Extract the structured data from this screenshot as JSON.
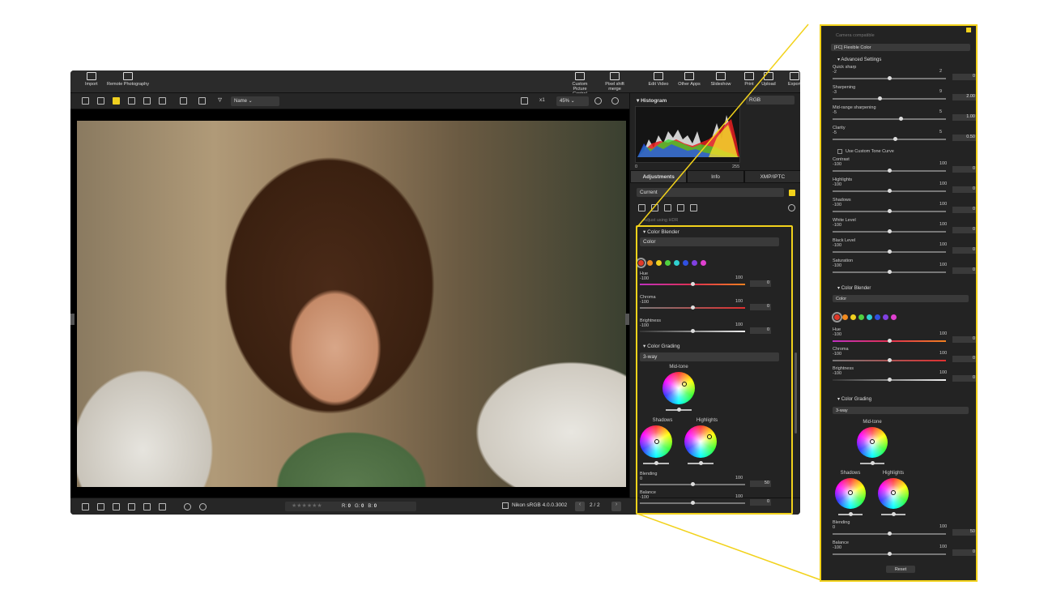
{
  "toolbar": {
    "left": [
      "Import",
      "Remote Photography"
    ],
    "right": [
      "Custom Picture Control",
      "Pixel shift merge",
      "Edit Video",
      "Other Apps",
      "Slideshow",
      "Print",
      "Upload",
      "Export"
    ]
  },
  "view": {
    "sort": "Name",
    "zoom_x": "x1",
    "zoom": "45%"
  },
  "bottombar": {
    "r_label": "R:",
    "r_value": "0",
    "g_label": "G:",
    "g_value": "0",
    "b_label": "B:",
    "b_value": "0",
    "profile": "Nikon sRGB 4.0.0.3002",
    "page": "2",
    "of": "2"
  },
  "histogram": {
    "title": "Histogram",
    "channel": "RGB",
    "min": "0",
    "max": "255"
  },
  "tabs": [
    "Adjustments",
    "Info",
    "XMP/IPTC"
  ],
  "panel": {
    "preset": "Current",
    "adjust_hdr": "Adjust using HDR",
    "color_blender": {
      "title": "Color Blender",
      "mode": "Color",
      "colors": [
        "#e03a2a",
        "#f08a20",
        "#f0d020",
        "#50d040",
        "#30d0d0",
        "#3050e0",
        "#8040e0",
        "#e040d0"
      ],
      "sliders": [
        {
          "label": "Hue",
          "min": "-100",
          "max": "100",
          "value": "0",
          "pos": 0.5,
          "track": "linear-gradient(90deg,#c030c0,#e03050,#f08020)"
        },
        {
          "label": "Chroma",
          "min": "-100",
          "max": "100",
          "value": "0",
          "pos": 0.5,
          "track": "linear-gradient(90deg,#777,#e03030)"
        },
        {
          "label": "Brightness",
          "min": "-100",
          "max": "100",
          "value": "0",
          "pos": 0.5,
          "track": "linear-gradient(90deg,#333,#eee)"
        }
      ]
    },
    "color_grading": {
      "title": "Color Grading",
      "mode": "3-way",
      "wheels": [
        "Mid-tone",
        "Shadows",
        "Highlights"
      ],
      "sliders": [
        {
          "label": "Blending",
          "min": "0",
          "max": "100",
          "value": "50",
          "pos": 0.5
        },
        {
          "label": "Balance",
          "min": "-100",
          "max": "100",
          "value": "0",
          "pos": 0.5
        }
      ]
    }
  },
  "zoom_panel": {
    "top_text": "Camera compatible",
    "picture_control": "[FC] Flexible Color",
    "advanced": "Advanced Settings",
    "adv_sliders": [
      {
        "label": "Quick sharp",
        "min": "-2",
        "max": "2",
        "value": "0",
        "pos": 0.5
      },
      {
        "label": "Sharpening",
        "min": "-3",
        "max": "9",
        "value": "2.00",
        "pos": 0.42
      },
      {
        "label": "Mid-range sharpening",
        "min": "-5",
        "max": "5",
        "value": "1.00",
        "pos": 0.6
      },
      {
        "label": "Clarity",
        "min": "-5",
        "max": "5",
        "value": "0.50",
        "pos": 0.55
      }
    ],
    "tone_curve": "Use Custom Tone Curve",
    "tone_sliders": [
      {
        "label": "Contrast",
        "min": "-100",
        "max": "100",
        "value": "0",
        "pos": 0.5
      },
      {
        "label": "Highlights",
        "min": "-100",
        "max": "100",
        "value": "0",
        "pos": 0.5
      },
      {
        "label": "Shadows",
        "min": "-100",
        "max": "100",
        "value": "0",
        "pos": 0.5
      },
      {
        "label": "White Level",
        "min": "-100",
        "max": "100",
        "value": "0",
        "pos": 0.5
      },
      {
        "label": "Black Level",
        "min": "-100",
        "max": "100",
        "value": "0",
        "pos": 0.5
      },
      {
        "label": "Saturation",
        "min": "-100",
        "max": "100",
        "value": "0",
        "pos": 0.5
      }
    ],
    "reset": "Reset"
  }
}
